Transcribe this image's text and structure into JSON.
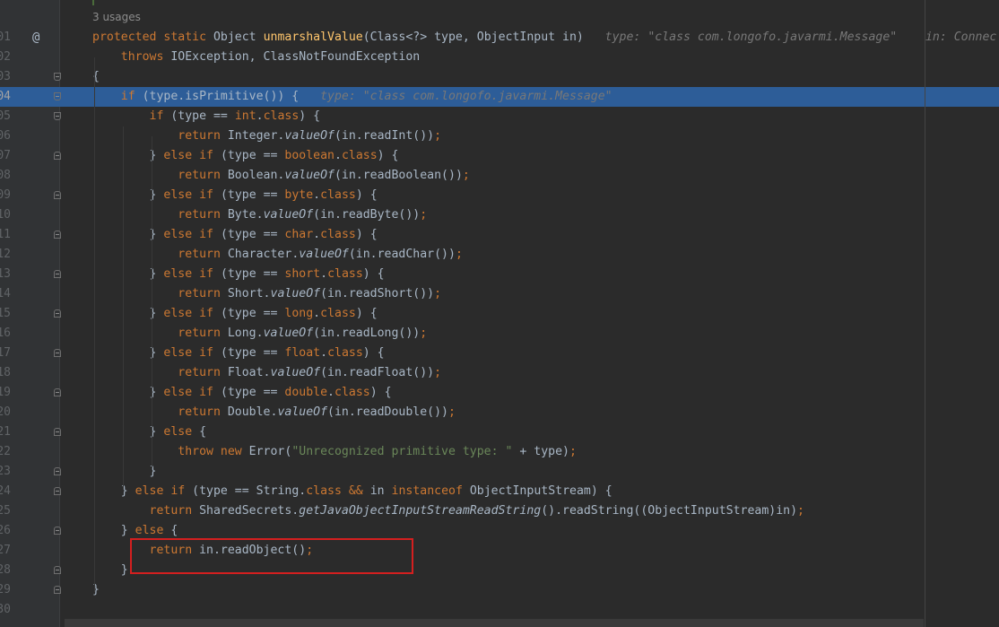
{
  "editor": {
    "usages_hint": "3 usages",
    "highlighted_line": "04",
    "colors": {
      "background": "#2b2b2b",
      "keyword": "#cc7832",
      "method_decl": "#ffc66d",
      "string": "#6a8759",
      "selection": "#2d5d98",
      "annotation_box": "#d41f1f"
    },
    "lines": [
      {
        "num": "01",
        "gutter_icon": "@",
        "tokens": [
          [
            "protected static ",
            "kw"
          ],
          [
            "Object ",
            "id"
          ],
          [
            "unmarshalValue",
            "fn"
          ],
          [
            "(Class<?> type, ObjectInput in)",
            "id"
          ],
          [
            "   type: \"class com.longofo.javarmi.Message\"    in: Connec",
            "hint"
          ]
        ]
      },
      {
        "num": "02",
        "tokens": [
          [
            "    throws ",
            "kw"
          ],
          [
            "IOException, ClassNotFoundException",
            "id"
          ]
        ]
      },
      {
        "num": "03",
        "fold": "down",
        "tokens": [
          [
            "{",
            "id"
          ]
        ]
      },
      {
        "num": "04",
        "fold": "down",
        "tokens": [
          [
            "    if ",
            "kw"
          ],
          [
            "(type.isPrimitive()) {",
            "id"
          ],
          [
            "   type: \"class com.longofo.javarmi.Message\"",
            "hint"
          ]
        ]
      },
      {
        "num": "05",
        "fold": "down",
        "tokens": [
          [
            "        if ",
            "kw"
          ],
          [
            "(type == ",
            "id"
          ],
          [
            "int",
            "kw"
          ],
          [
            ".",
            "id"
          ],
          [
            "class",
            "kw"
          ],
          [
            ") {",
            "id"
          ]
        ]
      },
      {
        "num": "06",
        "tokens": [
          [
            "            return ",
            "kw"
          ],
          [
            "Integer.",
            "id"
          ],
          [
            "valueOf",
            "it"
          ],
          [
            "(in.readInt())",
            "id"
          ],
          [
            ";",
            "kw"
          ]
        ]
      },
      {
        "num": "07",
        "fold": "up",
        "tokens": [
          [
            "        } ",
            "id"
          ],
          [
            "else if ",
            "kw"
          ],
          [
            "(type == ",
            "id"
          ],
          [
            "boolean",
            "kw"
          ],
          [
            ".",
            "id"
          ],
          [
            "class",
            "kw"
          ],
          [
            ") {",
            "id"
          ]
        ]
      },
      {
        "num": "08",
        "tokens": [
          [
            "            return ",
            "kw"
          ],
          [
            "Boolean.",
            "id"
          ],
          [
            "valueOf",
            "it"
          ],
          [
            "(in.readBoolean())",
            "id"
          ],
          [
            ";",
            "kw"
          ]
        ]
      },
      {
        "num": "09",
        "fold": "up",
        "tokens": [
          [
            "        } ",
            "id"
          ],
          [
            "else if ",
            "kw"
          ],
          [
            "(type == ",
            "id"
          ],
          [
            "byte",
            "kw"
          ],
          [
            ".",
            "id"
          ],
          [
            "class",
            "kw"
          ],
          [
            ") {",
            "id"
          ]
        ]
      },
      {
        "num": "10",
        "tokens": [
          [
            "            return ",
            "kw"
          ],
          [
            "Byte.",
            "id"
          ],
          [
            "valueOf",
            "it"
          ],
          [
            "(in.readByte())",
            "id"
          ],
          [
            ";",
            "kw"
          ]
        ]
      },
      {
        "num": "11",
        "fold": "up",
        "tokens": [
          [
            "        } ",
            "id"
          ],
          [
            "else if ",
            "kw"
          ],
          [
            "(type == ",
            "id"
          ],
          [
            "char",
            "kw"
          ],
          [
            ".",
            "id"
          ],
          [
            "class",
            "kw"
          ],
          [
            ") {",
            "id"
          ]
        ]
      },
      {
        "num": "12",
        "tokens": [
          [
            "            return ",
            "kw"
          ],
          [
            "Character.",
            "id"
          ],
          [
            "valueOf",
            "it"
          ],
          [
            "(in.readChar())",
            "id"
          ],
          [
            ";",
            "kw"
          ]
        ]
      },
      {
        "num": "13",
        "fold": "up",
        "tokens": [
          [
            "        } ",
            "id"
          ],
          [
            "else if ",
            "kw"
          ],
          [
            "(type == ",
            "id"
          ],
          [
            "short",
            "kw"
          ],
          [
            ".",
            "id"
          ],
          [
            "class",
            "kw"
          ],
          [
            ") {",
            "id"
          ]
        ]
      },
      {
        "num": "14",
        "tokens": [
          [
            "            return ",
            "kw"
          ],
          [
            "Short.",
            "id"
          ],
          [
            "valueOf",
            "it"
          ],
          [
            "(in.readShort())",
            "id"
          ],
          [
            ";",
            "kw"
          ]
        ]
      },
      {
        "num": "15",
        "fold": "up",
        "tokens": [
          [
            "        } ",
            "id"
          ],
          [
            "else if ",
            "kw"
          ],
          [
            "(type == ",
            "id"
          ],
          [
            "long",
            "kw"
          ],
          [
            ".",
            "id"
          ],
          [
            "class",
            "kw"
          ],
          [
            ") {",
            "id"
          ]
        ]
      },
      {
        "num": "16",
        "tokens": [
          [
            "            return ",
            "kw"
          ],
          [
            "Long.",
            "id"
          ],
          [
            "valueOf",
            "it"
          ],
          [
            "(in.readLong())",
            "id"
          ],
          [
            ";",
            "kw"
          ]
        ]
      },
      {
        "num": "17",
        "fold": "up",
        "tokens": [
          [
            "        } ",
            "id"
          ],
          [
            "else if ",
            "kw"
          ],
          [
            "(type == ",
            "id"
          ],
          [
            "float",
            "kw"
          ],
          [
            ".",
            "id"
          ],
          [
            "class",
            "kw"
          ],
          [
            ") {",
            "id"
          ]
        ]
      },
      {
        "num": "18",
        "tokens": [
          [
            "            return ",
            "kw"
          ],
          [
            "Float.",
            "id"
          ],
          [
            "valueOf",
            "it"
          ],
          [
            "(in.readFloat())",
            "id"
          ],
          [
            ";",
            "kw"
          ]
        ]
      },
      {
        "num": "19",
        "fold": "up",
        "tokens": [
          [
            "        } ",
            "id"
          ],
          [
            "else if ",
            "kw"
          ],
          [
            "(type == ",
            "id"
          ],
          [
            "double",
            "kw"
          ],
          [
            ".",
            "id"
          ],
          [
            "class",
            "kw"
          ],
          [
            ") {",
            "id"
          ]
        ]
      },
      {
        "num": "20",
        "tokens": [
          [
            "            return ",
            "kw"
          ],
          [
            "Double.",
            "id"
          ],
          [
            "valueOf",
            "it"
          ],
          [
            "(in.readDouble())",
            "id"
          ],
          [
            ";",
            "kw"
          ]
        ]
      },
      {
        "num": "21",
        "fold": "up",
        "tokens": [
          [
            "        } ",
            "id"
          ],
          [
            "else ",
            "kw"
          ],
          [
            "{",
            "id"
          ]
        ]
      },
      {
        "num": "22",
        "tokens": [
          [
            "            throw new ",
            "kw"
          ],
          [
            "Error(",
            "id"
          ],
          [
            "\"Unrecognized primitive type: \"",
            "str"
          ],
          [
            " + type)",
            "id"
          ],
          [
            ";",
            "kw"
          ]
        ]
      },
      {
        "num": "23",
        "fold": "up",
        "tokens": [
          [
            "        }",
            "id"
          ]
        ]
      },
      {
        "num": "24",
        "fold": "up",
        "tokens": [
          [
            "    } ",
            "id"
          ],
          [
            "else if ",
            "kw"
          ],
          [
            "(type == String.",
            "id"
          ],
          [
            "class ",
            "kw"
          ],
          [
            "&& ",
            "kw"
          ],
          [
            "in ",
            "id"
          ],
          [
            "instanceof ",
            "kw"
          ],
          [
            "ObjectInputStream) {",
            "id"
          ]
        ]
      },
      {
        "num": "25",
        "tokens": [
          [
            "        return ",
            "kw"
          ],
          [
            "SharedSecrets.",
            "id"
          ],
          [
            "getJavaObjectInputStreamReadString",
            "it"
          ],
          [
            "().readString((ObjectInputStream)in)",
            "id"
          ],
          [
            ";",
            "kw"
          ]
        ]
      },
      {
        "num": "26",
        "fold": "up",
        "tokens": [
          [
            "    } ",
            "id"
          ],
          [
            "else ",
            "kw"
          ],
          [
            "{",
            "id"
          ]
        ]
      },
      {
        "num": "27",
        "tokens": [
          [
            "        return ",
            "kw"
          ],
          [
            "in.readObject()",
            "id"
          ],
          [
            ";",
            "kw"
          ]
        ]
      },
      {
        "num": "28",
        "fold": "up",
        "tokens": [
          [
            "    }",
            "id"
          ]
        ]
      },
      {
        "num": "29",
        "fold": "up",
        "tokens": [
          [
            "}",
            "id"
          ]
        ]
      },
      {
        "num": "30",
        "tokens": []
      }
    ]
  }
}
